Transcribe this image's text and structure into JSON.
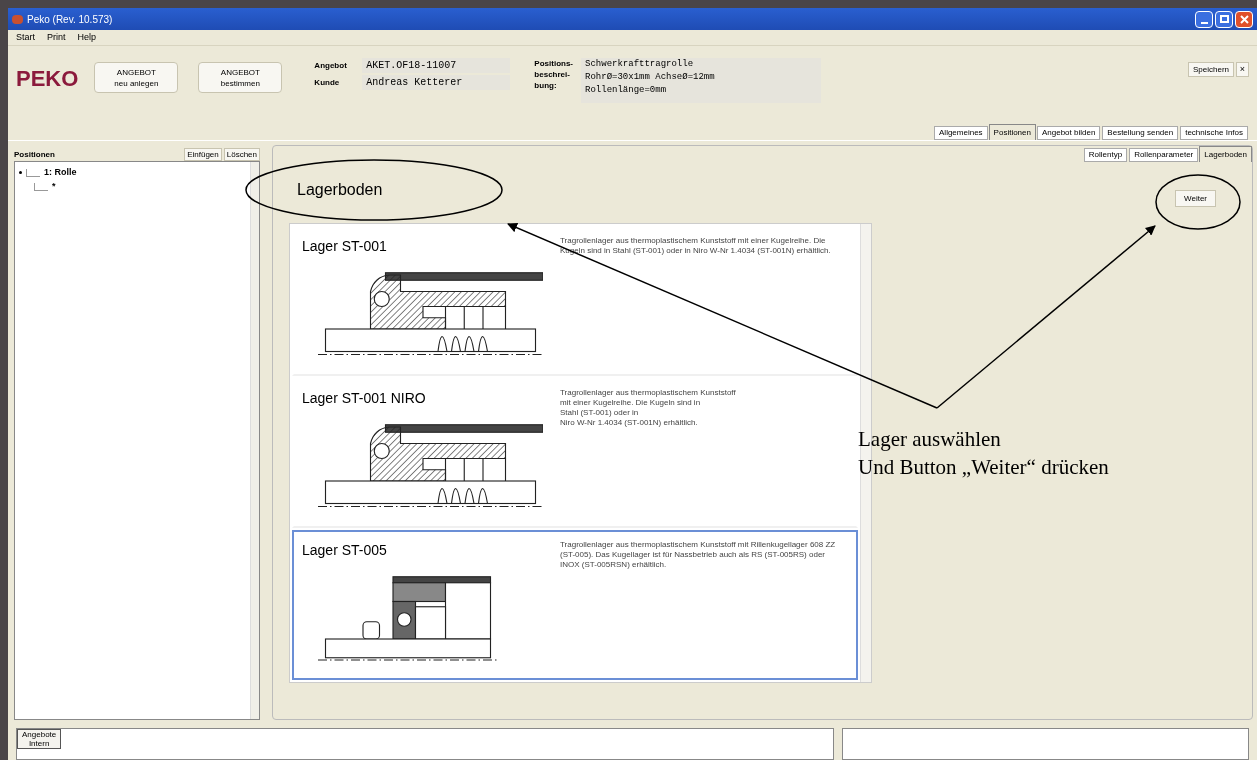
{
  "window": {
    "title": "Peko (Rev. 10.573)"
  },
  "menu": [
    "Start",
    "Print",
    "Help"
  ],
  "logo": "PEKO",
  "header_buttons": [
    {
      "line1": "ANGEBOT",
      "line2": "neu anlegen"
    },
    {
      "line1": "ANGEBOT",
      "line2": "bestimmen"
    }
  ],
  "fields": [
    {
      "label": "Angebot",
      "value": "AKET.OF18-11007"
    },
    {
      "label": "Kunde",
      "value": "Andreas Ketterer"
    }
  ],
  "description": {
    "label": "Positions-\nbeschrei-\nbung:",
    "value": "Schwerkrafttragrolle\nRohrØ=30x1mm AchseØ=12mm\nRollenlänge=0mm"
  },
  "save_button": "Speichern",
  "close_button": "×",
  "tabs": [
    {
      "label": "Allgemeines",
      "selected": false
    },
    {
      "label": "Positionen",
      "selected": true
    },
    {
      "label": "Angebot bilden",
      "selected": false
    },
    {
      "label": "Bestellung senden",
      "selected": false
    },
    {
      "label": "technische Infos",
      "selected": false
    }
  ],
  "subtabs": [
    {
      "label": "Rollentyp",
      "selected": false
    },
    {
      "label": "Rollenparameter",
      "selected": false
    },
    {
      "label": "Lagerboden",
      "selected": true
    }
  ],
  "positions": {
    "title": "Positionen",
    "buttons": [
      "Einfügen",
      "Löschen"
    ],
    "tree": [
      {
        "label": "1: Rolle",
        "children": [
          {
            "label": "*"
          }
        ]
      }
    ]
  },
  "content": {
    "heading": "Lagerboden",
    "next_button": "Weiter",
    "bearings": [
      {
        "kind": "ball",
        "name": "Lager ST-001",
        "text": "Tragrollenlager aus thermoplastischem Kunststoff mit einer Kugelreihe. Die Kugeln sind in Stahl (ST-001) oder in Niro W-Nr 1.4034 (ST-001N) erhältlich.",
        "selected": false
      },
      {
        "kind": "ball",
        "name": "Lager ST-001 NIRO",
        "text": "Tragrollenlager aus thermoplastischem Kunststoff\nmit einer Kugelreihe. Die Kugeln sind in\nStahl (ST-001) oder in\nNiro W-Nr 1.4034 (ST-001N) erhältlich.",
        "selected": false
      },
      {
        "kind": "deepgroove",
        "name": "Lager ST-005",
        "text": "Tragrollenlager aus thermoplastischem Kunststoff mit Rillenkugellager 608 ZZ (ST-005). Das Kugellager ist für Nassbetrieb auch als RS (ST-005RS) oder INOX (ST-005RSN) erhältlich.",
        "selected": true
      }
    ]
  },
  "bottom_tab": "Angebote\nIntern",
  "annotation": {
    "line1": "Lager auswählen",
    "line2": "Und Button „Weiter“ drücken"
  }
}
